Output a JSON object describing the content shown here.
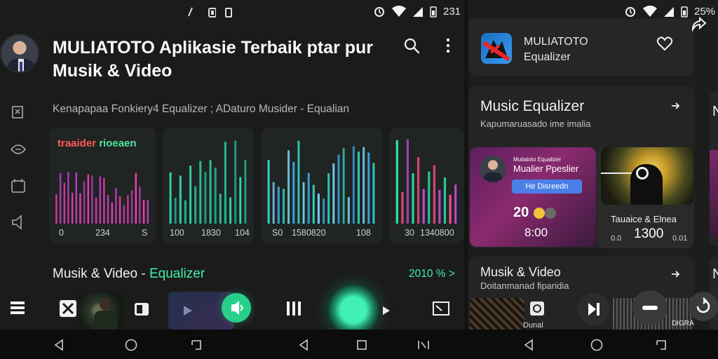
{
  "left_status": {
    "time": "231",
    "battery_icon": "battery-icon"
  },
  "right_status": {
    "battery": "25%"
  },
  "left": {
    "title": "MULIATOTO Aplikasie Terbaik ptar pur Musik & Video",
    "subtitle": "Kenapapaa Fonkiery4 Equalizer ; ADaturo Musider - Equalian",
    "eq1_title_a": "traaider",
    "eq1_title_b": "rioeaen",
    "eq_panels": [
      {
        "labels": [
          "0",
          "234",
          "S"
        ]
      },
      {
        "labels": [
          "100",
          "1830",
          "104"
        ]
      },
      {
        "labels": [
          "S0",
          "1580820",
          "108"
        ]
      },
      {
        "labels": [
          "30",
          "1340800"
        ]
      }
    ],
    "section_title": "Musik & Video - ",
    "section_accent": "Equalizer",
    "section_count": "2010 %",
    "section_more": ">"
  },
  "right": {
    "header_title_1": "MULIATOTO",
    "header_title_2": "Equalizer",
    "eq_card_title": "Music Equalizer",
    "eq_card_sub": "Kapumaruasado ime imalia",
    "promo_small": "Muliatoto Equalizer",
    "promo_name": "Mualier Ppeslier",
    "promo_btn": "He Disreedn",
    "promo_num": "20",
    "promo_time": "8:00",
    "concert_title": "Tauaice & Elnea",
    "concert_lo": "0.0",
    "concert_num": "1300",
    "concert_hi": "0.01",
    "strip_letter": "N",
    "strip_letter_2": "N",
    "mv_title": "Musik & Video",
    "mv_sub": "Doitanmanad fiparidia",
    "tile_text": "Dunal",
    "noise_text": "DIGRA"
  },
  "colors": {
    "accent_green": "#3ff0a8",
    "magenta": "#e040c8",
    "button_blue": "#4a7fe8"
  }
}
